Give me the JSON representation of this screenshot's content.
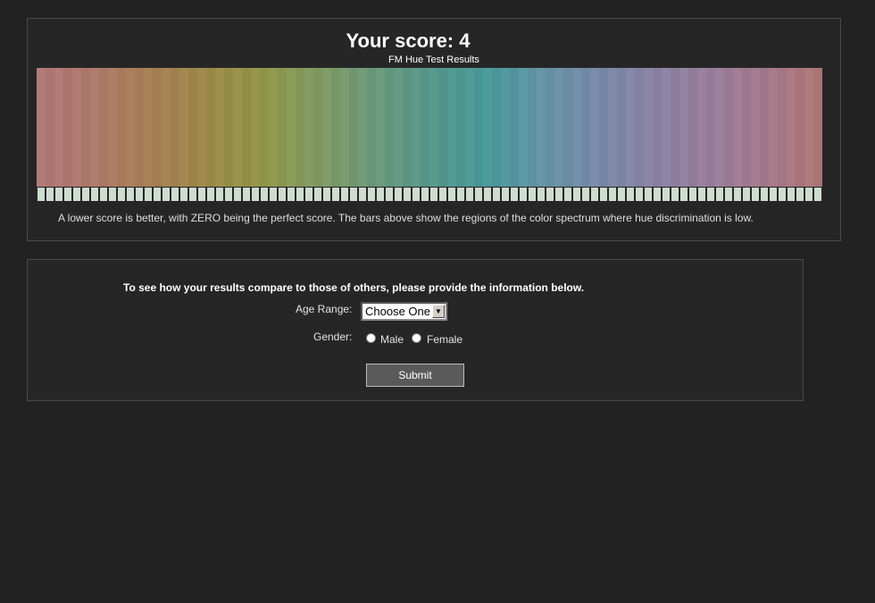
{
  "results": {
    "title": "Your score: 4",
    "subtitle": "FM Hue Test Results",
    "note": "A lower score is better, with ZERO being the perfect score. The bars above show the regions of the color spectrum where hue discrimination is low.",
    "spectrum_colors": [
      "#b27b7b",
      "#b07c6c",
      "#a98257",
      "#9f8c4c",
      "#95994b",
      "#839c64",
      "#6e9b7e",
      "#599a8d",
      "#4b9b9c",
      "#6696a7",
      "#7b8cab",
      "#8b86a6",
      "#9a819e",
      "#a67b8f",
      "#b07a7b"
    ],
    "spectrum_tick_color": "#cfdcd0"
  },
  "form": {
    "intro": "To see how your results compare to those of others, please provide the information below.",
    "age_label": "Age Range:",
    "age_value": "Choose One",
    "gender_label": "Gender:",
    "male_label": "Male",
    "female_label": "Female",
    "submit_label": "Submit"
  }
}
